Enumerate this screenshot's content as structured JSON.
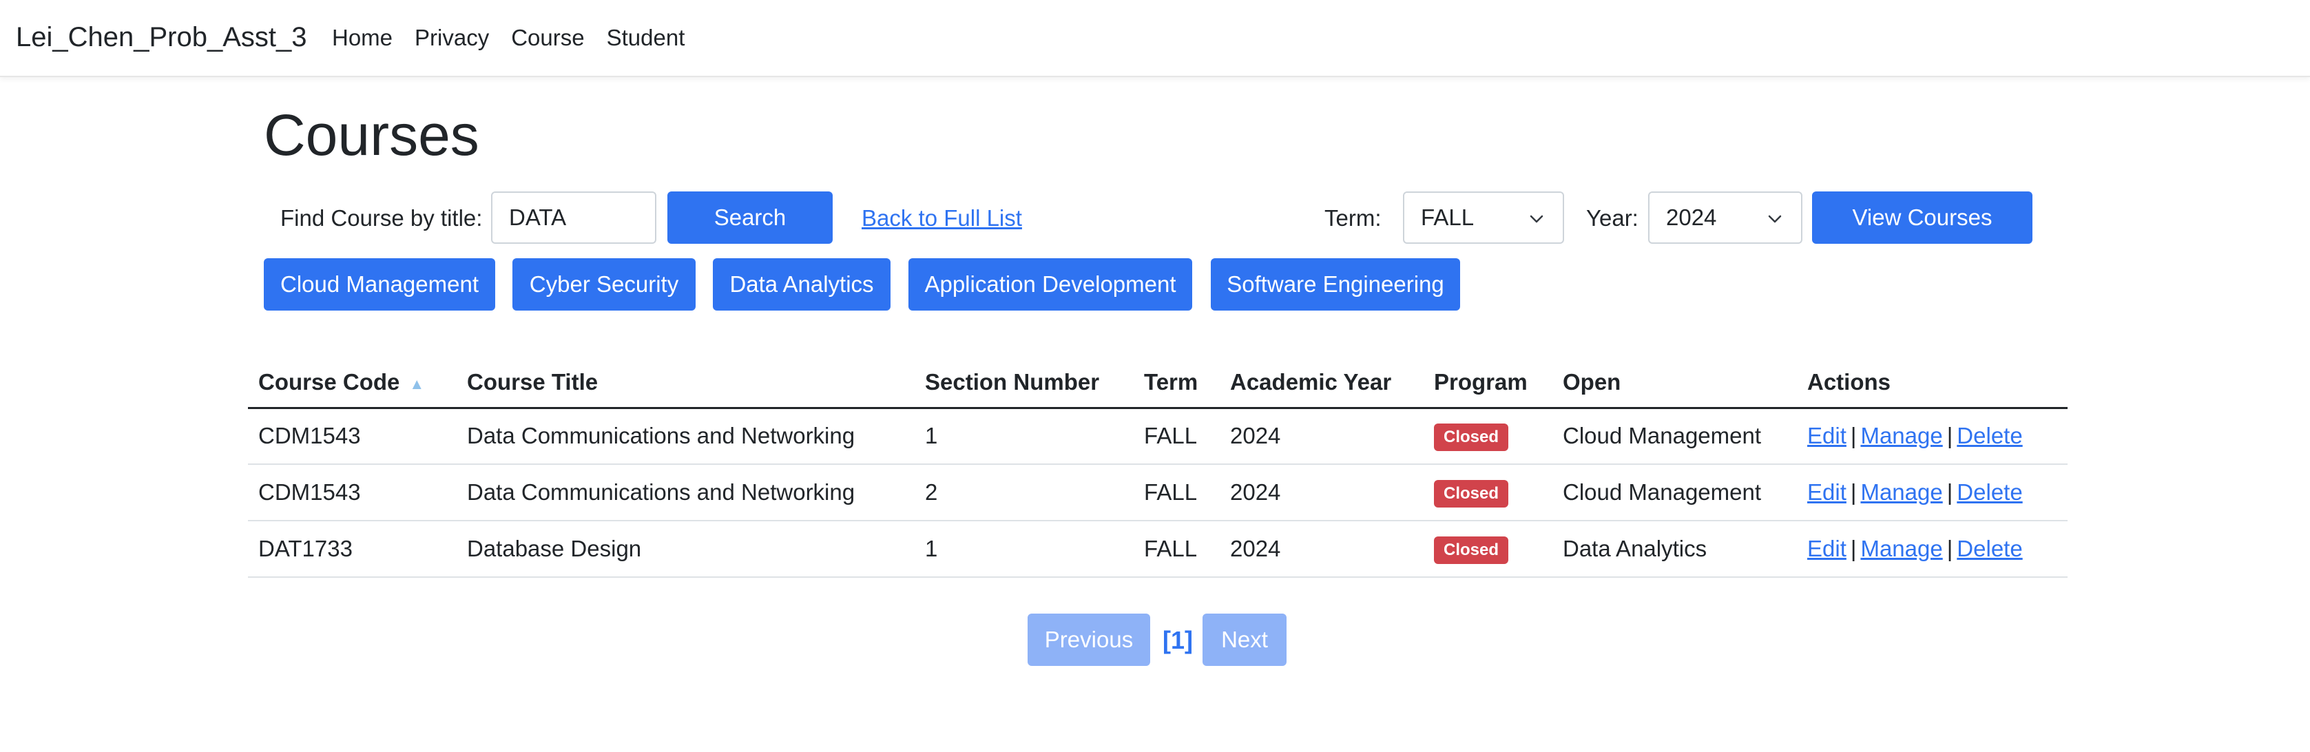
{
  "navbar": {
    "brand": "Lei_Chen_Prob_Asst_3",
    "links": [
      "Home",
      "Privacy",
      "Course",
      "Student"
    ]
  },
  "page": {
    "title": "Courses"
  },
  "search": {
    "label": "Find Course by title:",
    "value": "DATA",
    "button": "Search",
    "back_link": "Back to Full List"
  },
  "filter": {
    "term_label": "Term:",
    "term_value": "FALL",
    "year_label": "Year:",
    "year_value": "2024",
    "view_button": "View Courses"
  },
  "programs": [
    "Cloud Management",
    "Cyber Security",
    "Data Analytics",
    "Application Development",
    "Software Engineering"
  ],
  "table": {
    "headers": [
      "Course Code",
      "Course Title",
      "Section Number",
      "Term",
      "Academic Year",
      "Program",
      "Open",
      "Actions"
    ],
    "sort_indicator": "▲",
    "rows": [
      {
        "code": "CDM1543",
        "title": "Data Communications and Networking",
        "section": "1",
        "term": "FALL",
        "year": "2024",
        "status": "Closed",
        "program": "Cloud Management"
      },
      {
        "code": "CDM1543",
        "title": "Data Communications and Networking",
        "section": "2",
        "term": "FALL",
        "year": "2024",
        "status": "Closed",
        "program": "Cloud Management"
      },
      {
        "code": "DAT1733",
        "title": "Database Design",
        "section": "1",
        "term": "FALL",
        "year": "2024",
        "status": "Closed",
        "program": "Data Analytics"
      }
    ],
    "actions": {
      "edit": "Edit",
      "manage": "Manage",
      "delete": "Delete",
      "separator": "|"
    }
  },
  "pagination": {
    "previous": "Previous",
    "current": "[1]",
    "next": "Next"
  },
  "colors": {
    "primary": "#2f73f1",
    "danger": "#d1434b",
    "disabled": "#8eb2f7"
  }
}
